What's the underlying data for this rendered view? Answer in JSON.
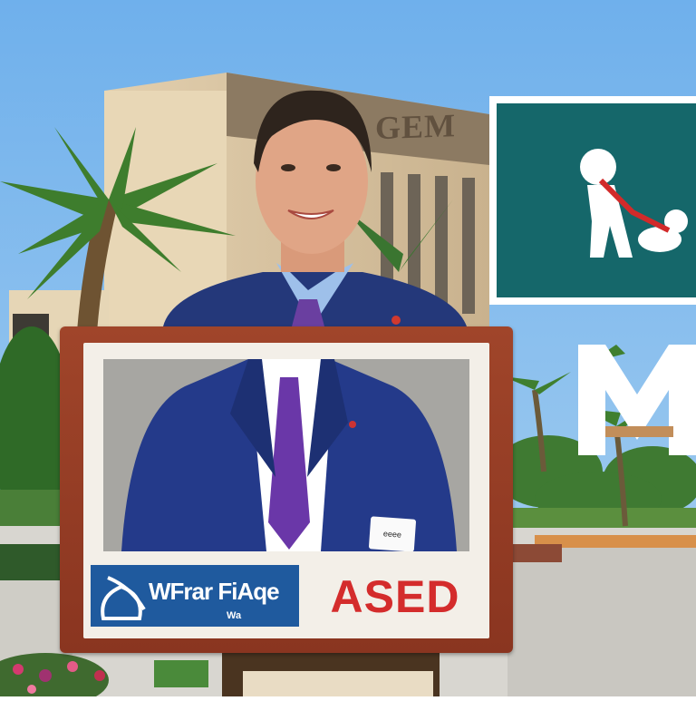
{
  "scene": {
    "description_colors": {
      "sky": "#77b6ee",
      "teal_panel": "#15676a",
      "suit": "#24387a",
      "placard_frame": "#9a3d24",
      "logo_blue": "#1f5a9e",
      "sign_red": "#d42c2c"
    }
  },
  "building_sign": "GEM",
  "placard": {
    "logo_text": "WFrar FiAqe",
    "logo_subtext": "Wa",
    "red_text": "ASED",
    "name_tag": "eeee"
  },
  "icons": [
    "person-with-child-pictogram-icon",
    "m-letter-sign-icon"
  ]
}
